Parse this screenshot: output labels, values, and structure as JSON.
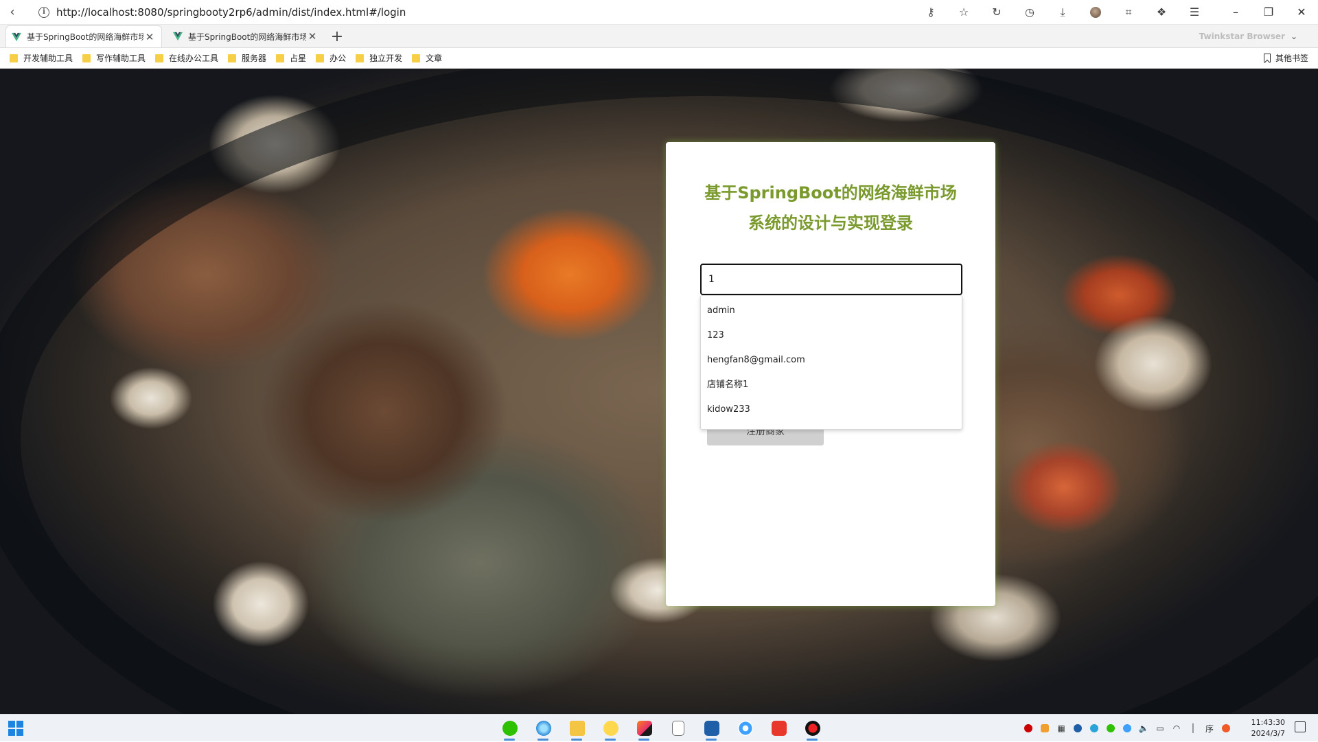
{
  "browser": {
    "url": "http://localhost:8080/springbooty2rp6/admin/dist/index.html#/login",
    "brand": "Twinkstar Browser",
    "tabs": [
      {
        "title": "基于SpringBoot的网络海鲜市场系统的设计与实现",
        "active": true
      },
      {
        "title": "基于SpringBoot的网络海鲜市场系统的设计与实现",
        "active": false
      }
    ],
    "bookmarks": [
      "开发辅助工具",
      "写作辅助工具",
      "在线办公工具",
      "服务器",
      "占星",
      "办公",
      "独立开发",
      "文章"
    ],
    "other_bookmarks": "其他书签"
  },
  "login": {
    "title_line1": "基于SpringBoot的网络海鲜市场",
    "title_line2": "系统的设计与实现登录",
    "username_value": "1",
    "register_button": "注册商家"
  },
  "autocomplete": [
    "admin",
    "123",
    "hengfan8@gmail.com",
    "店铺名称1",
    "kidow233"
  ],
  "taskbar": {
    "time": "11:43:30",
    "date": "2024/3/7"
  },
  "colors": {
    "title": "#7a9a2d",
    "panel_glow": "#78aa3c",
    "folder": "#f7cf47",
    "taskbar_accent": "#4a90d9"
  }
}
